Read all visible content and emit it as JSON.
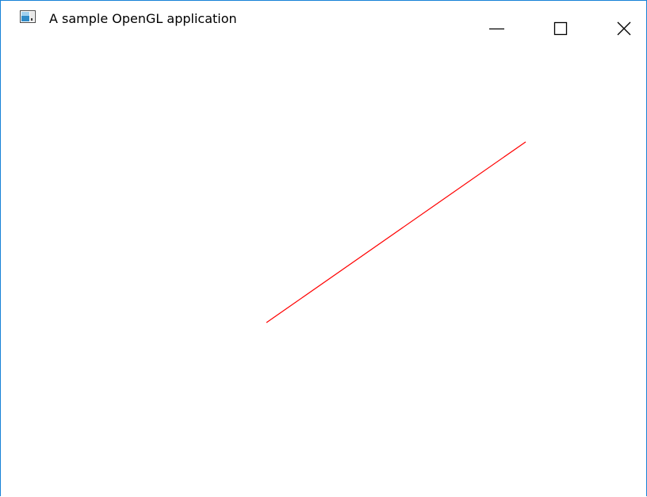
{
  "window": {
    "title": "A sample OpenGL application",
    "app_icon": "window-app-icon",
    "controls": {
      "minimize_icon": "minimize-icon",
      "maximize_icon": "maximize-icon",
      "close_icon": "close-icon"
    },
    "border_color": "#1883d7"
  },
  "scene": {
    "background_color": "#ffffff",
    "line_color": "#ff0000"
  }
}
